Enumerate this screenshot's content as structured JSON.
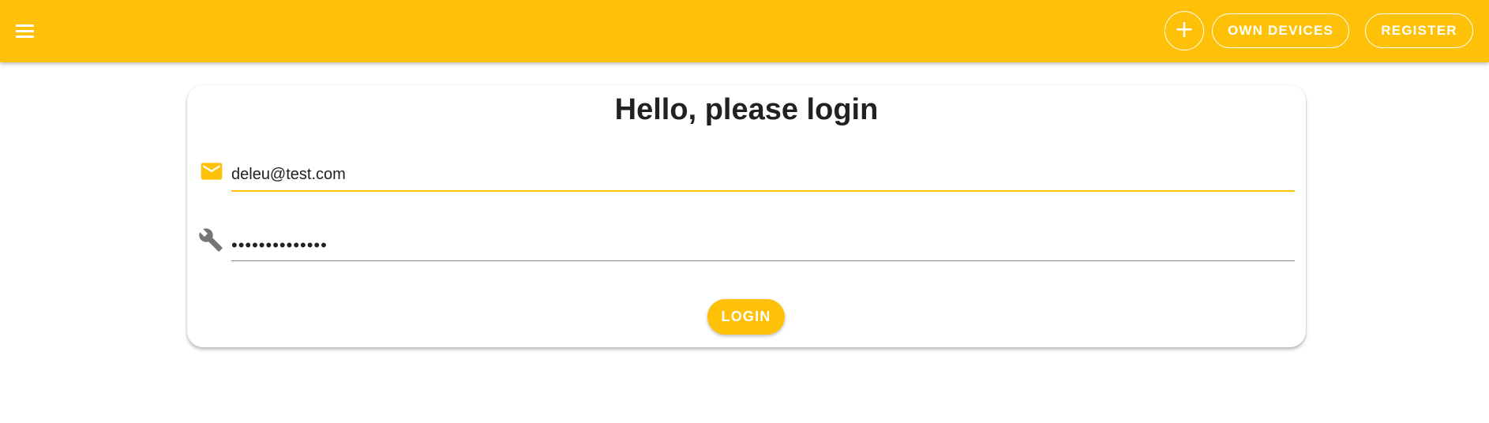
{
  "appbar": {
    "menu_icon": "hamburger-menu-icon",
    "add_icon": "plus-icon",
    "add_symbol": "+",
    "own_devices_label": "OWN DEVICES",
    "register_label": "REGISTER"
  },
  "login_card": {
    "title": "Hello, please login",
    "email": {
      "icon": "mail-icon",
      "value": "deleu@test.com"
    },
    "password": {
      "icon": "wrench-icon",
      "value": "••••••••••••••"
    },
    "login_label": "LOGIN"
  },
  "colors": {
    "accent": "#ffc107",
    "text": "#212121",
    "icon_gray": "#757575",
    "white": "#ffffff"
  }
}
